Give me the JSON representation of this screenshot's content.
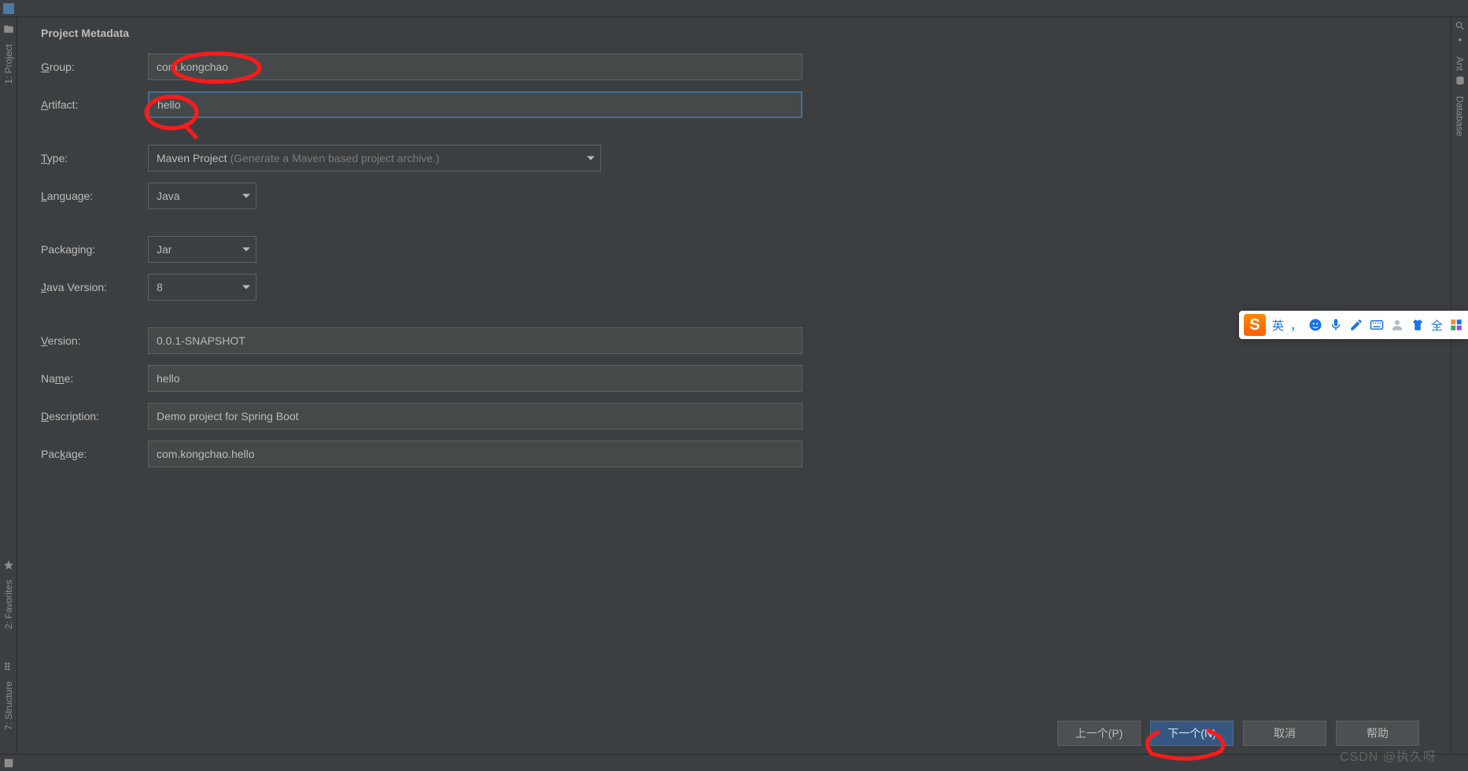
{
  "title": "Project Metadata",
  "form": {
    "group_label": "Group:",
    "group_ul": "G",
    "group_value": "com.kongchao",
    "artifact_label": "rtifact:",
    "artifact_ul": "A",
    "artifact_value": "hello",
    "type_label": "ype:",
    "type_ul": "T",
    "type_value": "Maven Project",
    "type_hint": "(Generate a Maven based project archive.)",
    "language_label": "anguage:",
    "language_ul": "L",
    "language_value": "Java",
    "packaging_label": "Packaging:",
    "packaging_value": "Jar",
    "javaversion_label": "ava Version:",
    "javaversion_ul": "J",
    "javaversion_value": "8",
    "version_label": "ersion:",
    "version_ul": "V",
    "version_value": "0.0.1-SNAPSHOT",
    "name_label_pre": "Na",
    "name_label_ul": "m",
    "name_label_post": "e:",
    "name_value": "hello",
    "description_label": "escription:",
    "description_ul": "D",
    "description_value": "Demo project for Spring Boot",
    "package_label_pre": "Pac",
    "package_label_ul": "k",
    "package_label_post": "age:",
    "package_value": "com.kongchao.hello"
  },
  "buttons": {
    "previous": "上一个(P)",
    "next": "下一个(N)",
    "cancel": "取消",
    "help": "帮助"
  },
  "sidebar": {
    "project": "1: Project",
    "favorites": "2: Favorites",
    "structure": "7: Structure",
    "ant": "Ant",
    "database": "Database"
  },
  "ime": {
    "logo": "S",
    "lang": "英",
    "full": "全"
  },
  "watermark": "CSDN @执久呀"
}
